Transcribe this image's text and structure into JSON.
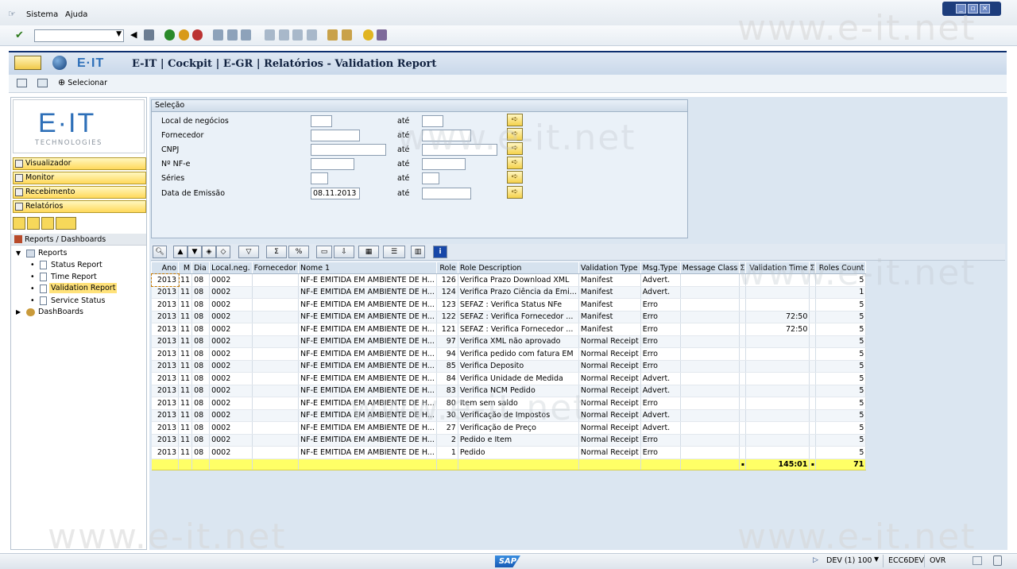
{
  "menu": {
    "system": "Sistema",
    "help": "Ajuda"
  },
  "window": {
    "title": "E-IT | Cockpit | E-GR | Relatórios - Validation Report"
  },
  "app_toolbar": {
    "select_label": "Selecionar"
  },
  "logo": {
    "name": "E·IT",
    "subtitle": "TECHNOLOGIES"
  },
  "nav": {
    "viewer": "Visualizador",
    "monitor": "Monitor",
    "receiving": "Recebimento",
    "reports": "Relatórios"
  },
  "tree": {
    "root": "Reports / Dashboards",
    "reports": "Reports",
    "items": [
      "Status Report",
      "Time Report",
      "Validation Report",
      "Service Status"
    ],
    "dashboards": "DashBoards"
  },
  "selection": {
    "title": "Seleção",
    "to_label": "até",
    "fields": [
      {
        "label": "Local de negócios",
        "value": ""
      },
      {
        "label": "Fornecedor",
        "value": ""
      },
      {
        "label": "CNPJ",
        "value": ""
      },
      {
        "label": "Nº NF-e",
        "value": ""
      },
      {
        "label": "Séries",
        "value": ""
      },
      {
        "label": "Data de Emissão",
        "value": "08.11.2013"
      }
    ]
  },
  "grid": {
    "headers": [
      "Ano",
      "M",
      "Dia",
      "Local.neg.",
      "Fornecedor",
      "Nome 1",
      "Role",
      "Role Description",
      "Validation Type",
      "Msg.Type",
      "Message Class",
      "Σ",
      "Validation Time",
      "Σ",
      "Roles Count"
    ],
    "rows": [
      [
        "2013",
        "11",
        "08",
        "0002",
        "",
        "NF-E EMITIDA EM AMBIENTE DE H...",
        "126",
        "Verifica Prazo Download XML",
        "Manifest",
        "Advert.",
        "",
        "",
        "",
        "",
        "5"
      ],
      [
        "2013",
        "11",
        "08",
        "0002",
        "",
        "NF-E EMITIDA EM AMBIENTE DE H...",
        "124",
        "Verifica Prazo Ciência da Emi...",
        "Manifest",
        "Advert.",
        "",
        "",
        "",
        "",
        "1"
      ],
      [
        "2013",
        "11",
        "08",
        "0002",
        "",
        "NF-E EMITIDA EM AMBIENTE DE H...",
        "123",
        "SEFAZ : Verifica Status NFe",
        "Manifest",
        "Erro",
        "",
        "",
        "",
        "",
        "5"
      ],
      [
        "2013",
        "11",
        "08",
        "0002",
        "",
        "NF-E EMITIDA EM AMBIENTE DE H...",
        "122",
        "SEFAZ : Verifica Fornecedor ...",
        "Manifest",
        "Erro",
        "",
        "",
        "72:50",
        "",
        "5"
      ],
      [
        "2013",
        "11",
        "08",
        "0002",
        "",
        "NF-E EMITIDA EM AMBIENTE DE H...",
        "121",
        "SEFAZ : Verifica Fornecedor ...",
        "Manifest",
        "Erro",
        "",
        "",
        "72:50",
        "",
        "5"
      ],
      [
        "2013",
        "11",
        "08",
        "0002",
        "",
        "NF-E EMITIDA EM AMBIENTE DE H...",
        "97",
        "Verifica XML não aprovado",
        "Normal Receipt",
        "Erro",
        "",
        "",
        "",
        "",
        "5"
      ],
      [
        "2013",
        "11",
        "08",
        "0002",
        "",
        "NF-E EMITIDA EM AMBIENTE DE H...",
        "94",
        "Verifica pedido com fatura EM",
        "Normal Receipt",
        "Erro",
        "",
        "",
        "",
        "",
        "5"
      ],
      [
        "2013",
        "11",
        "08",
        "0002",
        "",
        "NF-E EMITIDA EM AMBIENTE DE H...",
        "85",
        "Verifica Deposito",
        "Normal Receipt",
        "Erro",
        "",
        "",
        "",
        "",
        "5"
      ],
      [
        "2013",
        "11",
        "08",
        "0002",
        "",
        "NF-E EMITIDA EM AMBIENTE DE H...",
        "84",
        "Verifica Unidade de Medida",
        "Normal Receipt",
        "Advert.",
        "",
        "",
        "",
        "",
        "5"
      ],
      [
        "2013",
        "11",
        "08",
        "0002",
        "",
        "NF-E EMITIDA EM AMBIENTE DE H...",
        "83",
        "Verifica NCM Pedido",
        "Normal Receipt",
        "Advert.",
        "",
        "",
        "",
        "",
        "5"
      ],
      [
        "2013",
        "11",
        "08",
        "0002",
        "",
        "NF-E EMITIDA EM AMBIENTE DE H...",
        "80",
        "Item sem saldo",
        "Normal Receipt",
        "Erro",
        "",
        "",
        "",
        "",
        "5"
      ],
      [
        "2013",
        "11",
        "08",
        "0002",
        "",
        "NF-E EMITIDA EM AMBIENTE DE H...",
        "30",
        "Verificação de Impostos",
        "Normal Receipt",
        "Advert.",
        "",
        "",
        "",
        "",
        "5"
      ],
      [
        "2013",
        "11",
        "08",
        "0002",
        "",
        "NF-E EMITIDA EM AMBIENTE DE H...",
        "27",
        "Verificação de Preço",
        "Normal Receipt",
        "Advert.",
        "",
        "",
        "",
        "",
        "5"
      ],
      [
        "2013",
        "11",
        "08",
        "0002",
        "",
        "NF-E EMITIDA EM AMBIENTE DE H...",
        "2",
        "Pedido e Item",
        "Normal Receipt",
        "Erro",
        "",
        "",
        "",
        "",
        "5"
      ],
      [
        "2013",
        "11",
        "08",
        "0002",
        "",
        "NF-E EMITIDA EM AMBIENTE DE H...",
        "1",
        "Pedido",
        "Normal Receipt",
        "Erro",
        "",
        "",
        "",
        "",
        "5"
      ]
    ],
    "totals": {
      "validation_time": "145:01",
      "roles_count": "71",
      "marker": "▪"
    }
  },
  "status": {
    "system": "DEV (1) 100",
    "server": "ECC6DEV",
    "mode": "OVR",
    "brand": "SAP"
  },
  "watermark": "www.e-it.net",
  "colors": {
    "nav_button": "#ffd95a",
    "total_row": "#ffff66",
    "title_border": "#0d2f6e"
  }
}
